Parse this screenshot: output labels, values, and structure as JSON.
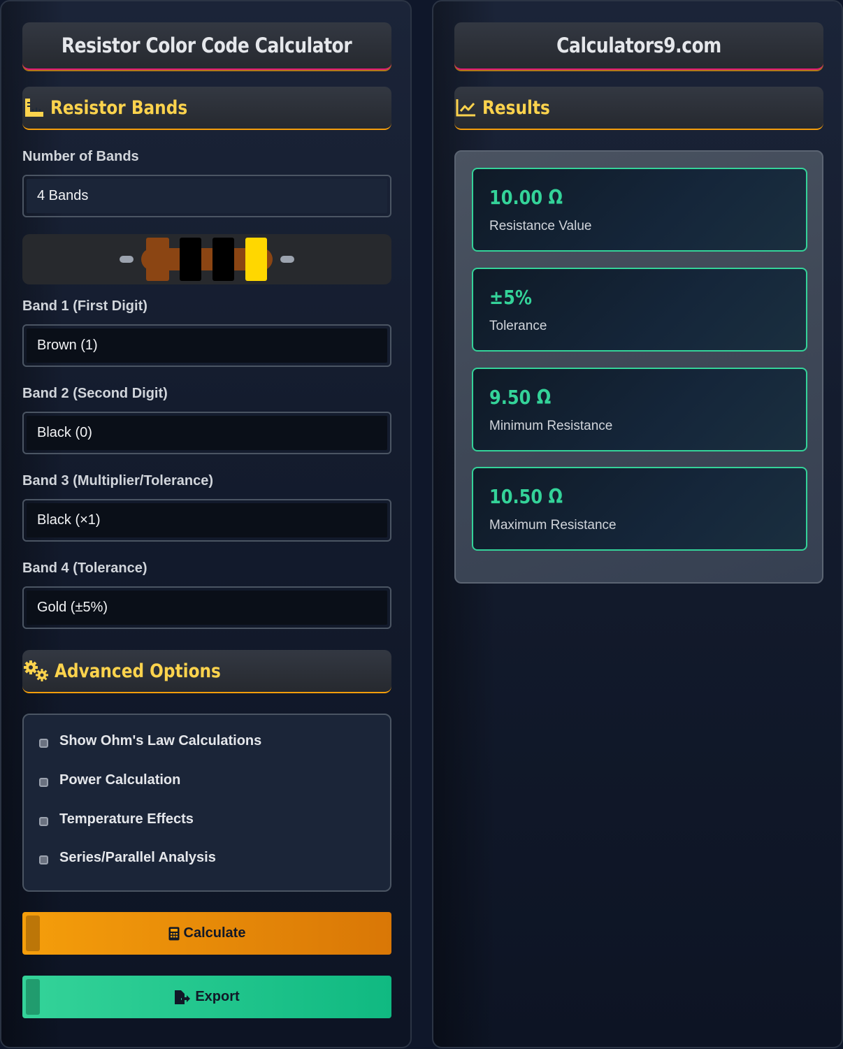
{
  "left_panel": {
    "title": "Resistor Color Code Calculator",
    "bands_section": {
      "title": "Resistor Bands",
      "icon": "ruler-icon"
    },
    "number_of_bands": {
      "label": "Number of Bands",
      "value": "4 Bands"
    },
    "resistor_preview": {
      "band_colors": [
        "#8b4513",
        "#000000",
        "#000000",
        "#ffd700"
      ],
      "body_color": "#8b4513",
      "lead_color": "#9ca3af"
    },
    "band1": {
      "label": "Band 1 (First Digit)",
      "value": "Brown (1)"
    },
    "band2": {
      "label": "Band 2 (Second Digit)",
      "value": "Black (0)"
    },
    "band3": {
      "label": "Band 3 (Multiplier/Tolerance)",
      "value": "Black (×1)"
    },
    "band4": {
      "label": "Band 4 (Tolerance)",
      "value": "Gold (±5%)"
    },
    "advanced_section": {
      "title": "Advanced Options",
      "icon": "gears-icon"
    },
    "options": [
      {
        "label": "Show Ohm's Law Calculations",
        "checked": false
      },
      {
        "label": "Power Calculation",
        "checked": false
      },
      {
        "label": "Temperature Effects",
        "checked": false
      },
      {
        "label": "Series/Parallel Analysis",
        "checked": false
      }
    ],
    "calculate_button": {
      "label": "Calculate",
      "icon": "calculator-icon"
    },
    "export_button": {
      "label": "Export",
      "icon": "file-export-icon"
    }
  },
  "right_panel": {
    "title": "Calculators9.com",
    "results_section": {
      "title": "Results",
      "icon": "chart-line-icon"
    },
    "results": [
      {
        "value": "10.00 Ω",
        "label": "Resistance Value"
      },
      {
        "value": "±5%",
        "label": "Tolerance"
      },
      {
        "value": "9.50 Ω",
        "label": "Minimum Resistance"
      },
      {
        "value": "10.50 Ω",
        "label": "Maximum Resistance"
      }
    ]
  },
  "colors": {
    "accent_yellow": "#fcd34d",
    "accent_orange": "#f59e0b",
    "accent_green": "#34d399",
    "accent_pink": "#e11d74"
  }
}
